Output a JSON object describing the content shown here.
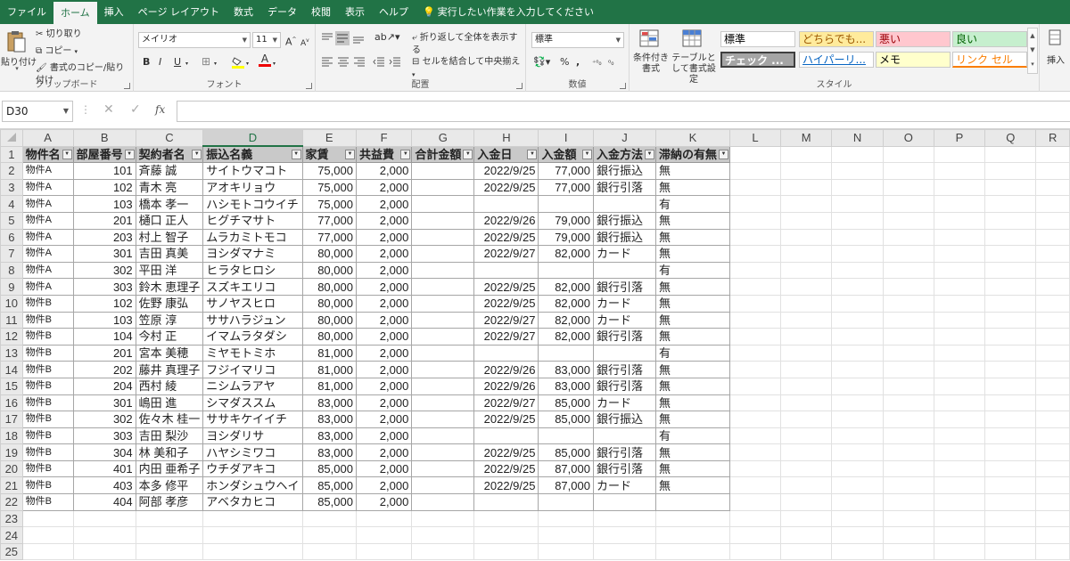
{
  "tabs": [
    "ファイル",
    "ホーム",
    "挿入",
    "ページ レイアウト",
    "数式",
    "データ",
    "校閲",
    "表示",
    "ヘルプ"
  ],
  "active_tab": "ホーム",
  "tellme": "実行したい作業を入力してください",
  "ribbon": {
    "clipboard": {
      "paste": "貼り付け",
      "cut": "切り取り",
      "copy": "コピー",
      "format_painter": "書式のコピー/貼り付け",
      "label": "クリップボード"
    },
    "font": {
      "name": "メイリオ",
      "size": "11",
      "label": "フォント"
    },
    "alignment": {
      "wrap": "折り返して全体を表示する",
      "merge": "セルを結合して中央揃え",
      "label": "配置"
    },
    "number": {
      "format": "標準",
      "label": "数値"
    },
    "styles": {
      "conditional": "条件付き書式",
      "table": "テーブルとして書式設定",
      "cells": [
        {
          "text": "標準",
          "bg": "#ffffff",
          "fg": "#000000"
        },
        {
          "text": "どちらでも...",
          "bg": "#ffeb9c",
          "fg": "#9c5700"
        },
        {
          "text": "悪い",
          "bg": "#ffc7ce",
          "fg": "#9c0006"
        },
        {
          "text": "良い",
          "bg": "#c6efce",
          "fg": "#006100"
        },
        {
          "text": "チェック ...",
          "bg": "#a5a5a5",
          "fg": "#ffffff"
        },
        {
          "text": "ハイパーリ...",
          "bg": "#ffffff",
          "fg": "#0563c1"
        },
        {
          "text": "メモ",
          "bg": "#ffffcc",
          "fg": "#000000"
        },
        {
          "text": "リンク セル",
          "bg": "#ffffff",
          "fg": "#fa7d00"
        }
      ],
      "label": "スタイル"
    },
    "insert": "挿入"
  },
  "namebox": "D30",
  "columns": [
    "A",
    "B",
    "C",
    "D",
    "E",
    "F",
    "G",
    "H",
    "I",
    "J",
    "K",
    "L",
    "M",
    "N",
    "O",
    "P",
    "Q",
    "R"
  ],
  "headers": [
    "物件名",
    "部屋番号",
    "契約者名",
    "振込名義",
    "家賃",
    "共益費",
    "合計金額",
    "入金日",
    "入金額",
    "入金方法",
    "滞納の有無"
  ],
  "rows": [
    [
      "物件A",
      "101",
      "斉藤 誠",
      "サイトウマコト",
      "75,000",
      "2,000",
      "",
      "2022/9/25",
      "77,000",
      "銀行振込",
      "無"
    ],
    [
      "物件A",
      "102",
      "青木 亮",
      "アオキリョウ",
      "75,000",
      "2,000",
      "",
      "2022/9/25",
      "77,000",
      "銀行引落",
      "無"
    ],
    [
      "物件A",
      "103",
      "橋本 孝一",
      "ハシモトコウイチ",
      "75,000",
      "2,000",
      "",
      "",
      "",
      "",
      "有"
    ],
    [
      "物件A",
      "201",
      "樋口 正人",
      "ヒグチマサト",
      "77,000",
      "2,000",
      "",
      "2022/9/26",
      "79,000",
      "銀行振込",
      "無"
    ],
    [
      "物件A",
      "203",
      "村上 智子",
      "ムラカミトモコ",
      "77,000",
      "2,000",
      "",
      "2022/9/25",
      "79,000",
      "銀行振込",
      "無"
    ],
    [
      "物件A",
      "301",
      "吉田 真美",
      "ヨシダマナミ",
      "80,000",
      "2,000",
      "",
      "2022/9/27",
      "82,000",
      "カード",
      "無"
    ],
    [
      "物件A",
      "302",
      "平田 洋",
      "ヒラタヒロシ",
      "80,000",
      "2,000",
      "",
      "",
      "",
      "",
      "有"
    ],
    [
      "物件A",
      "303",
      "鈴木 恵理子",
      "スズキエリコ",
      "80,000",
      "2,000",
      "",
      "2022/9/25",
      "82,000",
      "銀行引落",
      "無"
    ],
    [
      "物件B",
      "102",
      "佐野 康弘",
      "サノヤスヒロ",
      "80,000",
      "2,000",
      "",
      "2022/9/25",
      "82,000",
      "カード",
      "無"
    ],
    [
      "物件B",
      "103",
      "笠原 淳",
      "ササハラジュン",
      "80,000",
      "2,000",
      "",
      "2022/9/27",
      "82,000",
      "カード",
      "無"
    ],
    [
      "物件B",
      "104",
      "今村 正",
      "イマムラタダシ",
      "80,000",
      "2,000",
      "",
      "2022/9/27",
      "82,000",
      "銀行引落",
      "無"
    ],
    [
      "物件B",
      "201",
      "宮本 美穂",
      "ミヤモトミホ",
      "81,000",
      "2,000",
      "",
      "",
      "",
      "",
      "有"
    ],
    [
      "物件B",
      "202",
      "藤井 真理子",
      "フジイマリコ",
      "81,000",
      "2,000",
      "",
      "2022/9/26",
      "83,000",
      "銀行引落",
      "無"
    ],
    [
      "物件B",
      "204",
      "西村 綾",
      "ニシムラアヤ",
      "81,000",
      "2,000",
      "",
      "2022/9/26",
      "83,000",
      "銀行引落",
      "無"
    ],
    [
      "物件B",
      "301",
      "嶋田 進",
      "シマダススム",
      "83,000",
      "2,000",
      "",
      "2022/9/27",
      "85,000",
      "カード",
      "無"
    ],
    [
      "物件B",
      "302",
      "佐々木 桂一",
      "ササキケイイチ",
      "83,000",
      "2,000",
      "",
      "2022/9/25",
      "85,000",
      "銀行振込",
      "無"
    ],
    [
      "物件B",
      "303",
      "吉田 梨沙",
      "ヨシダリサ",
      "83,000",
      "2,000",
      "",
      "",
      "",
      "",
      "有"
    ],
    [
      "物件B",
      "304",
      "林 美和子",
      "ハヤシミワコ",
      "83,000",
      "2,000",
      "",
      "2022/9/25",
      "85,000",
      "銀行引落",
      "無"
    ],
    [
      "物件B",
      "401",
      "内田 亜希子",
      "ウチダアキコ",
      "85,000",
      "2,000",
      "",
      "2022/9/25",
      "87,000",
      "銀行引落",
      "無"
    ],
    [
      "物件B",
      "403",
      "本多 修平",
      "ホンダシュウヘイ",
      "85,000",
      "2,000",
      "",
      "2022/9/25",
      "87,000",
      "カード",
      "無"
    ],
    [
      "物件B",
      "404",
      "阿部 孝彦",
      "アベタカヒコ",
      "85,000",
      "2,000",
      "",
      "",
      "",
      "",
      ""
    ]
  ],
  "extra_rows": [
    "23",
    "24",
    "25"
  ]
}
